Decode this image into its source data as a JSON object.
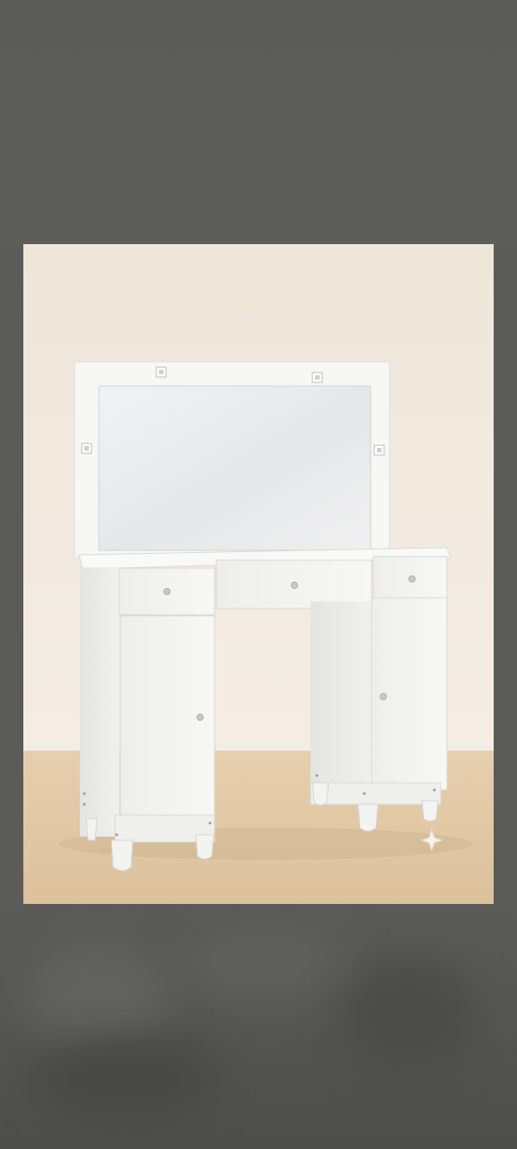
{
  "image": {
    "subject": "vanity-dressing-table-with-mirror",
    "colors": {
      "frame_background": "#5b5b59",
      "wall": "#efe7dc",
      "floor": "#e3c9a6",
      "furniture": "#f4f4f2"
    }
  }
}
